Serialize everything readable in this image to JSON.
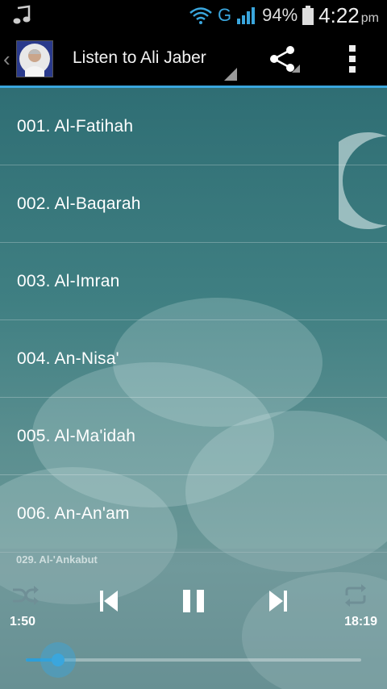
{
  "status_bar": {
    "network": "G",
    "battery": "94%",
    "time": "4:22",
    "ampm": "pm"
  },
  "action_bar": {
    "title": "Listen to Ali Jaber"
  },
  "surahs": [
    "001. Al-Fatihah",
    "002. Al-Baqarah",
    "003. Al-Imran",
    "004. An-Nisa'",
    "005. Al-Ma'idah",
    "006. An-An'am"
  ],
  "player": {
    "now_playing": "029. Al-'Ankabut",
    "elapsed": "1:50",
    "duration": "18:19",
    "progress_fraction": 0.096
  },
  "colors": {
    "accent": "#3aa6dd"
  }
}
